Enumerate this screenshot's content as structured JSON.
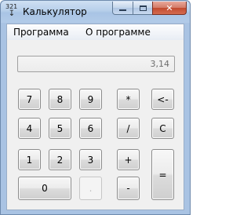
{
  "window": {
    "title": "Калькулятор",
    "icon": "calculator-icon",
    "icon_digits": "321",
    "minimize_icon": "minimize-icon",
    "maximize_icon": "maximize-icon",
    "close_icon": "close-icon",
    "close_glyph": "✕"
  },
  "menu": {
    "items": [
      "Программа",
      "О программе"
    ]
  },
  "display": {
    "value": "3,14"
  },
  "keys": {
    "seven": "7",
    "eight": "8",
    "nine": "9",
    "multiply": "*",
    "backspace": "<-",
    "four": "4",
    "five": "5",
    "six": "6",
    "divide": "/",
    "clear": "C",
    "one": "1",
    "two": "2",
    "three": "3",
    "plus": "+",
    "equals": "=",
    "zero": "0",
    "decimal": ".",
    "minus": "-"
  },
  "colors": {
    "frame": "#a9c3e3",
    "close_button": "#c24a2f",
    "client_bg": "#f0f0f0"
  }
}
